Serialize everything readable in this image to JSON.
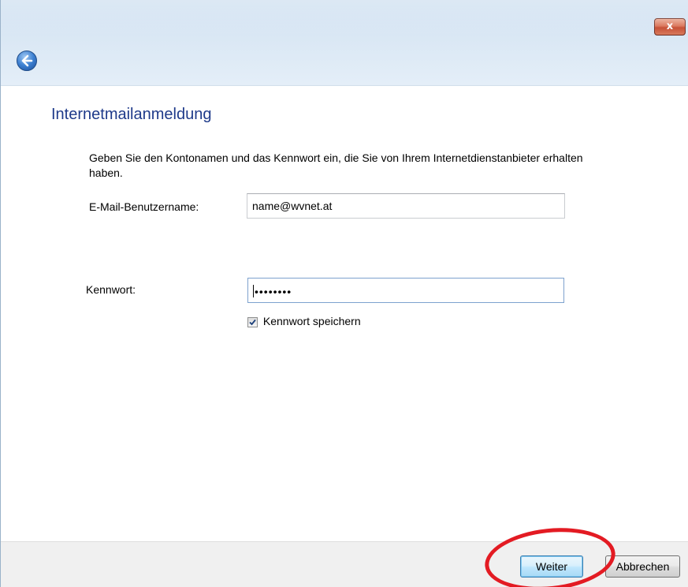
{
  "window": {
    "title": "",
    "close_glyph": "x",
    "close_icon": "close-icon",
    "back_icon": "back-arrow-icon"
  },
  "page": {
    "heading": "Internetmailanmeldung",
    "description": "Geben Sie den Kontonamen und das Kennwort ein, die Sie von Ihrem Internetdienstanbieter erhalten haben."
  },
  "form": {
    "username_label": "E-Mail-Benutzername:",
    "username_value": "name@wvnet.at",
    "password_label": "Kennwort:",
    "password_value": "••••••••",
    "remember_label": "Kennwort speichern",
    "remember_checked": true
  },
  "buttons": {
    "next_label": "Weiter",
    "cancel_label": "Abbrechen"
  },
  "colors": {
    "heading": "#1e3a8a",
    "annotation_circle": "#e31b23",
    "close_button": "#c24327"
  }
}
